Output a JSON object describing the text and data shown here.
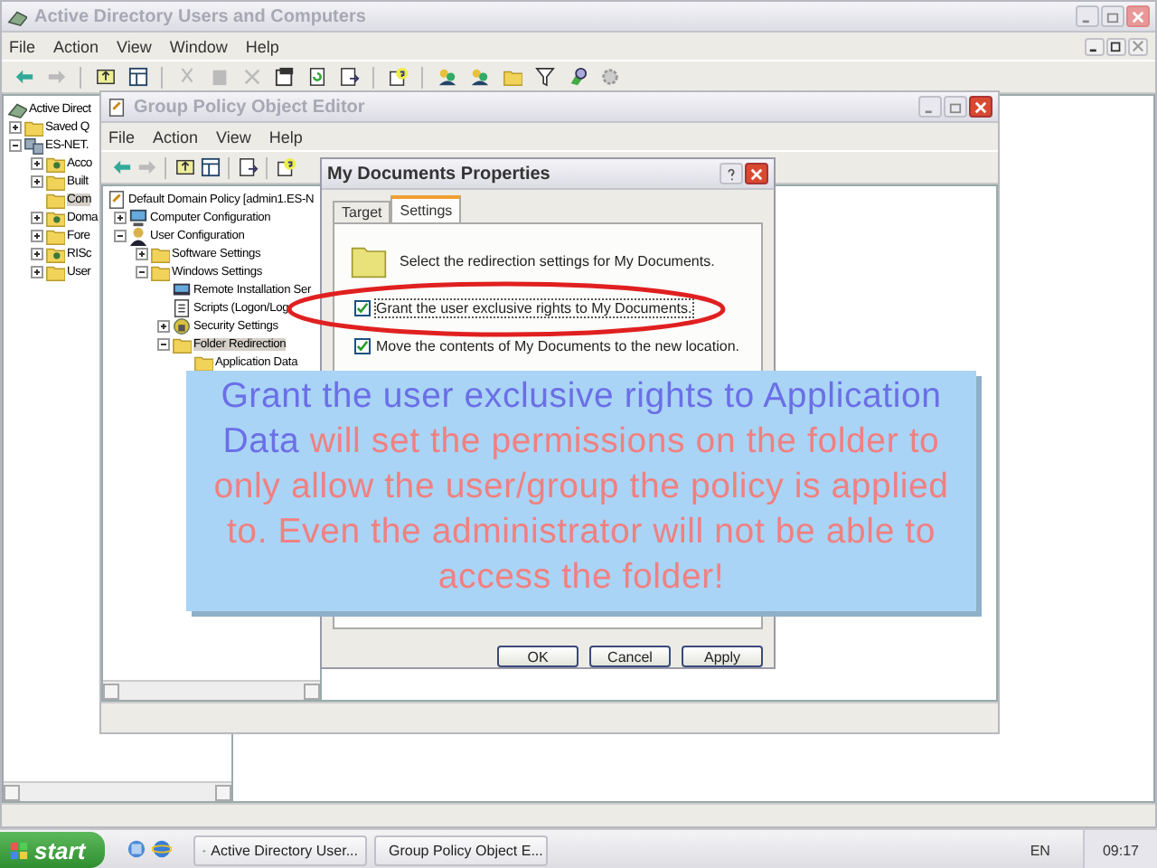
{
  "ad_window": {
    "title": "Active Directory Users and Computers",
    "menu": [
      "File",
      "Action",
      "View",
      "Window",
      "Help"
    ],
    "tree": [
      {
        "label": "Active Direct",
        "kind": "root",
        "selected": false,
        "children": [
          {
            "label": "Saved Q",
            "kind": "folder",
            "expanded": false,
            "selected": false
          },
          {
            "label": "ES-NET.",
            "kind": "domain",
            "expanded": true,
            "selected": false,
            "children": [
              {
                "label": "Acco",
                "kind": "ou",
                "expanded": false,
                "selected": false
              },
              {
                "label": "Built",
                "kind": "folder",
                "expanded": false,
                "selected": false
              },
              {
                "label": "Com",
                "kind": "folder",
                "selected": true
              },
              {
                "label": "Doma",
                "kind": "ou",
                "expanded": false,
                "selected": false
              },
              {
                "label": "Fore",
                "kind": "folder",
                "expanded": false,
                "selected": false
              },
              {
                "label": "RISc",
                "kind": "ou",
                "expanded": false,
                "selected": false
              },
              {
                "label": "User",
                "kind": "folder",
                "expanded": false,
                "selected": false
              }
            ]
          }
        ]
      }
    ]
  },
  "gpo_window": {
    "title": "Group Policy Object Editor",
    "menu": [
      "File",
      "Action",
      "View",
      "Help"
    ],
    "tree": [
      {
        "label": "Default Domain Policy [admin1.ES-N",
        "kind": "policy",
        "selected": false,
        "children": [
          {
            "label": "Computer Configuration",
            "kind": "computer",
            "expanded": false,
            "selected": false
          },
          {
            "label": "User Configuration",
            "kind": "user",
            "expanded": true,
            "selected": false,
            "children": [
              {
                "label": "Software Settings",
                "kind": "folder",
                "expanded": false,
                "selected": false
              },
              {
                "label": "Windows Settings",
                "kind": "folder",
                "expanded": true,
                "selected": false,
                "children": [
                  {
                    "label": "Remote Installation Ser",
                    "kind": "remote",
                    "selected": false
                  },
                  {
                    "label": "Scripts (Logon/Log",
                    "kind": "script",
                    "selected": false
                  },
                  {
                    "label": "Security Settings",
                    "kind": "security",
                    "expanded": false,
                    "selected": false
                  },
                  {
                    "label": "Folder Redirection",
                    "kind": "folder",
                    "expanded": true,
                    "selected": true,
                    "children": [
                      {
                        "label": "Application Data",
                        "kind": "folder",
                        "selected": false
                      }
                    ]
                  }
                ]
              }
            ]
          }
        ]
      }
    ]
  },
  "dialog": {
    "title": "My Documents Properties",
    "tabs": [
      {
        "label": "Target",
        "selected": false
      },
      {
        "label": "Settings",
        "selected": true
      }
    ],
    "description": "Select the redirection settings for My Documents.",
    "options": [
      {
        "label": "Grant the user exclusive rights to My Documents.",
        "checked": true,
        "focused": true
      },
      {
        "label": "Move the contents of My Documents to the new location.",
        "checked": true,
        "focused": false
      }
    ],
    "buttons": [
      "OK",
      "Cancel",
      "Apply"
    ]
  },
  "callout": {
    "segments": [
      {
        "text": "Grant the user exclusive rights to Application Data",
        "color": "#6b6fe6"
      },
      {
        "text": "will set the permissions on the folder to only allow the user/group the policy is applied to. Even the administrator will not be able to access the folder!",
        "color": "#f08080"
      }
    ]
  },
  "taskbar": {
    "start": "start",
    "tasks": [
      {
        "label": "Active Directory User...",
        "kind": "ad"
      },
      {
        "label": "Group Policy Object E...",
        "kind": "gpo"
      }
    ],
    "language": "EN",
    "clock": "09:17"
  }
}
